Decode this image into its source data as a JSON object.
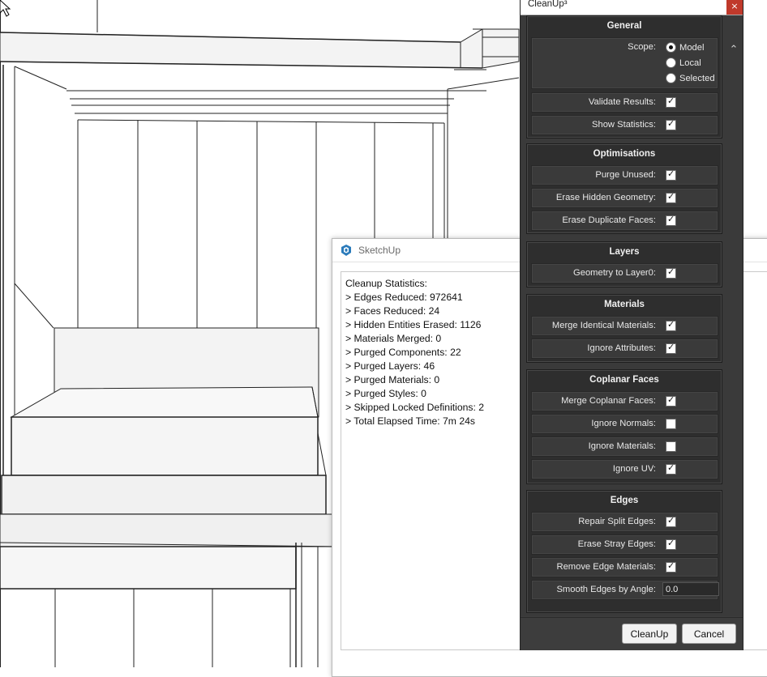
{
  "sketchup_dialog": {
    "title": "SketchUp",
    "lines": [
      "Cleanup Statistics:",
      "> Edges Reduced: 972641",
      "> Faces Reduced: 24",
      "> Hidden Entities Erased: 1126",
      "> Materials Merged: 0",
      "> Purged Components: 22",
      "> Purged Layers: 46",
      "> Purged Materials: 0",
      "> Purged Styles: 0",
      "> Skipped Locked Definitions: 2",
      "> Total Elapsed Time: 7m 24s"
    ]
  },
  "cleanup": {
    "title": "CleanUp³",
    "close_icon": "×",
    "general": {
      "title": "General",
      "scope_label": "Scope:",
      "scope_options": [
        "Model",
        "Local",
        "Selected"
      ],
      "scope_selected": "Model",
      "validate_label": "Validate Results:",
      "stats_label": "Show Statistics:"
    },
    "optimisations": {
      "title": "Optimisations",
      "purge_label": "Purge Unused:",
      "hidden_label": "Erase Hidden Geometry:",
      "dup_label": "Erase Duplicate Faces:"
    },
    "layers": {
      "title": "Layers",
      "layer0_label": "Geometry to Layer0:"
    },
    "materials": {
      "title": "Materials",
      "merge_label": "Merge Identical Materials:",
      "ignore_attr_label": "Ignore Attributes:"
    },
    "coplanar": {
      "title": "Coplanar Faces",
      "merge_label": "Merge Coplanar Faces:",
      "normals_label": "Ignore Normals:",
      "materials_label": "Ignore Materials:",
      "uv_label": "Ignore UV:"
    },
    "edges": {
      "title": "Edges",
      "repair_label": "Repair Split Edges:",
      "stray_label": "Erase Stray Edges:",
      "edge_mat_label": "Remove Edge Materials:",
      "smooth_label": "Smooth Edges by Angle:",
      "smooth_value": "0.0"
    },
    "checkboxes": {
      "validate": true,
      "stats": true,
      "purge": true,
      "hidden": true,
      "dup": true,
      "layer0": true,
      "merge_mat": true,
      "ignore_attr": true,
      "merge_coplanar": true,
      "normals": false,
      "materials": false,
      "uv": true,
      "repair": true,
      "stray": true,
      "edge_mat": true
    },
    "cleanup_button": "CleanUp",
    "cancel_button": "Cancel"
  }
}
